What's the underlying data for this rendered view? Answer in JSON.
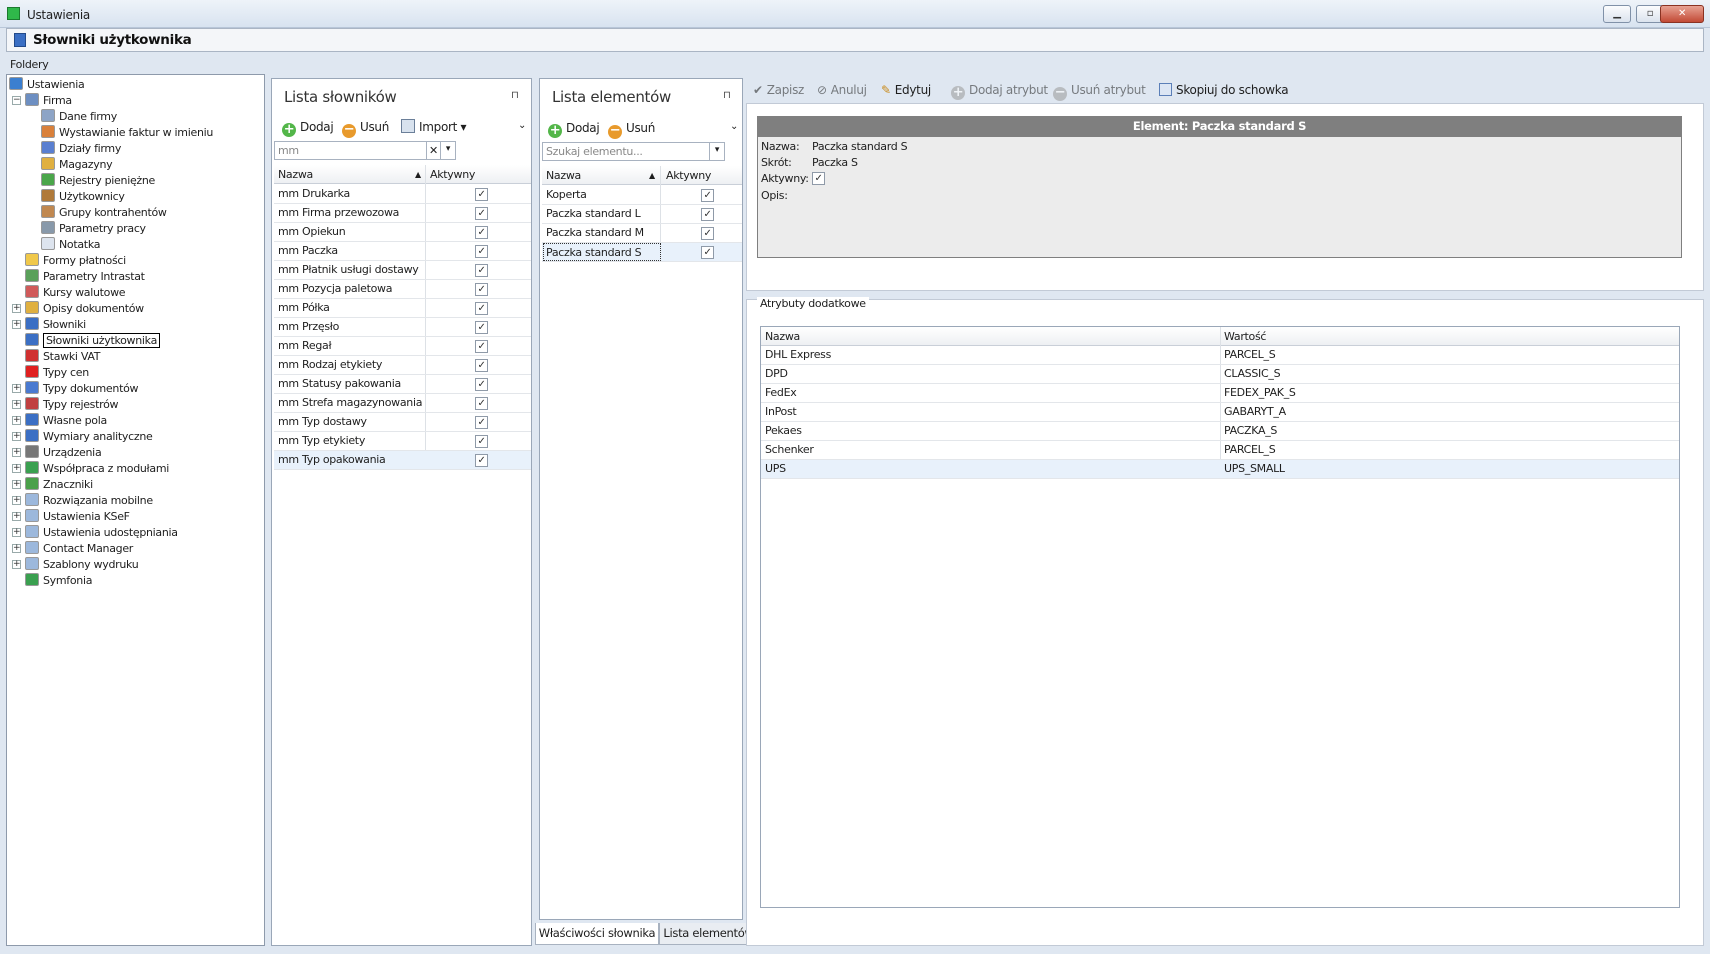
{
  "window": {
    "title": "Ustawienia",
    "btn_min": "▁",
    "btn_max": "▫",
    "btn_close": "✕"
  },
  "header": {
    "title": "Słowniki użytkownika"
  },
  "folders": {
    "label": "Foldery",
    "tree": [
      {
        "label": "Ustawienia",
        "level": 0,
        "expander": "",
        "icon_color": "#3b7fd0"
      },
      {
        "label": "Firma",
        "level": 1,
        "expander": "−",
        "icon_color": "#6d8fc2"
      },
      {
        "label": "Dane firmy",
        "level": 2,
        "expander": "",
        "icon_color": "#8da4c6"
      },
      {
        "label": "Wystawianie faktur w imieniu",
        "level": 2,
        "expander": "",
        "icon_color": "#d9803a"
      },
      {
        "label": "Działy firmy",
        "level": 2,
        "expander": "",
        "icon_color": "#5a7fd0"
      },
      {
        "label": "Magazyny",
        "level": 2,
        "expander": "",
        "icon_color": "#e0b040"
      },
      {
        "label": "Rejestry pieniężne",
        "level": 2,
        "expander": "",
        "icon_color": "#4aa64a"
      },
      {
        "label": "Użytkownicy",
        "level": 2,
        "expander": "",
        "icon_color": "#b07a3a"
      },
      {
        "label": "Grupy kontrahentów",
        "level": 2,
        "expander": "",
        "icon_color": "#c08850"
      },
      {
        "label": "Parametry pracy",
        "level": 2,
        "expander": "",
        "icon_color": "#8899aa"
      },
      {
        "label": "Notatka",
        "level": 2,
        "expander": "",
        "icon_color": "#dde4ee"
      },
      {
        "label": "Formy płatności",
        "level": 1,
        "expander": "",
        "icon_color": "#f0c84a"
      },
      {
        "label": "Parametry Intrastat",
        "level": 1,
        "expander": "",
        "icon_color": "#5aa05a"
      },
      {
        "label": "Kursy walutowe",
        "level": 1,
        "expander": "",
        "icon_color": "#d05a5a"
      },
      {
        "label": "Opisy dokumentów",
        "level": 1,
        "expander": "+",
        "icon_color": "#e0b040"
      },
      {
        "label": "Słowniki",
        "level": 1,
        "expander": "+",
        "icon_color": "#3b6fc4"
      },
      {
        "label": "Słowniki użytkownika",
        "level": 1,
        "expander": "",
        "icon_color": "#3b6fc4",
        "selected": true
      },
      {
        "label": "Stawki VAT",
        "level": 1,
        "expander": "",
        "icon_color": "#d03030"
      },
      {
        "label": "Typy cen",
        "level": 1,
        "expander": "",
        "icon_color": "#e02020"
      },
      {
        "label": "Typy dokumentów",
        "level": 1,
        "expander": "+",
        "icon_color": "#4a7ad0"
      },
      {
        "label": "Typy rejestrów",
        "level": 1,
        "expander": "+",
        "icon_color": "#c04040"
      },
      {
        "label": "Własne pola",
        "level": 1,
        "expander": "+",
        "icon_color": "#3b6fc4"
      },
      {
        "label": "Wymiary analityczne",
        "level": 1,
        "expander": "+",
        "icon_color": "#3b6fc4"
      },
      {
        "label": "Urządzenia",
        "level": 1,
        "expander": "+",
        "icon_color": "#777777"
      },
      {
        "label": "Współpraca z modułami",
        "level": 1,
        "expander": "+",
        "icon_color": "#3aa050"
      },
      {
        "label": "Znaczniki",
        "level": 1,
        "expander": "+",
        "icon_color": "#4aa04a"
      },
      {
        "label": "Rozwiązania mobilne",
        "level": 1,
        "expander": "+",
        "icon_color": "#9cb8dc"
      },
      {
        "label": "Ustawienia KSeF",
        "level": 1,
        "expander": "+",
        "icon_color": "#9cb8dc"
      },
      {
        "label": "Ustawienia udostępniania",
        "level": 1,
        "expander": "+",
        "icon_color": "#9cb8dc"
      },
      {
        "label": "Contact Manager",
        "level": 1,
        "expander": "+",
        "icon_color": "#9cb8dc"
      },
      {
        "label": "Szablony wydruku",
        "level": 1,
        "expander": "+",
        "icon_color": "#9cb8dc"
      },
      {
        "label": "Symfonia",
        "level": 1,
        "expander": "",
        "icon_color": "#3aa050"
      }
    ]
  },
  "dictionaries": {
    "title": "Lista słowników",
    "pin": "⊓",
    "add": "Dodaj",
    "remove": "Usuń",
    "import": "Import",
    "search_value": "mm",
    "clear": "✕",
    "col_name": "Nazwa",
    "col_active": "Aktywny",
    "rows": [
      {
        "name": "mm Drukarka",
        "active": "✓"
      },
      {
        "name": "mm Firma przewozowa",
        "active": "✓"
      },
      {
        "name": "mm Opiekun",
        "active": "✓"
      },
      {
        "name": "mm Paczka",
        "active": "✓"
      },
      {
        "name": "mm Płatnik usługi dostawy",
        "active": "✓"
      },
      {
        "name": "mm Pozycja paletowa",
        "active": "✓"
      },
      {
        "name": "mm Półka",
        "active": "✓"
      },
      {
        "name": "mm Przęsło",
        "active": "✓"
      },
      {
        "name": "mm Regał",
        "active": "✓"
      },
      {
        "name": "mm Rodzaj etykiety",
        "active": "✓"
      },
      {
        "name": "mm Statusy pakowania",
        "active": "✓"
      },
      {
        "name": "mm Strefa magazynowania",
        "active": "✓"
      },
      {
        "name": "mm Typ dostawy",
        "active": "✓"
      },
      {
        "name": "mm Typ etykiety",
        "active": "✓"
      },
      {
        "name": "mm Typ opakowania",
        "active": "✓",
        "selected": true
      }
    ]
  },
  "elements": {
    "title": "Lista elementów",
    "pin": "⊓",
    "add": "Dodaj",
    "remove": "Usuń",
    "search_placeholder": "Szukaj elementu...",
    "col_name": "Nazwa",
    "col_active": "Aktywny",
    "rows": [
      {
        "name": "Koperta",
        "active": "✓"
      },
      {
        "name": "Paczka standard L",
        "active": "✓"
      },
      {
        "name": "Paczka standard M",
        "active": "✓"
      },
      {
        "name": "Paczka standard S",
        "active": "✓",
        "selected": true
      }
    ],
    "tabs": [
      "Właściwości słownika",
      "Lista elementów"
    ]
  },
  "toolbar": {
    "save": "Zapisz",
    "cancel": "Anuluj",
    "edit": "Edytuj",
    "add_attr": "Dodaj atrybut",
    "remove_attr": "Usuń atrybut",
    "copy": "Skopiuj do schowka"
  },
  "detail": {
    "header": "Element: Paczka standard S",
    "name_label": "Nazwa:",
    "name_value": "Paczka standard S",
    "short_label": "Skrót:",
    "short_value": "Paczka S",
    "active_label": "Aktywny:",
    "active_value": "✓",
    "desc_label": "Opis:"
  },
  "attributes": {
    "title": "Atrybuty dodatkowe",
    "col_name": "Nazwa",
    "col_value": "Wartość",
    "rows": [
      {
        "name": "DHL Express",
        "value": "PARCEL_S"
      },
      {
        "name": "DPD",
        "value": "CLASSIC_S"
      },
      {
        "name": "FedEx",
        "value": "FEDEX_PAK_S"
      },
      {
        "name": "InPost",
        "value": "GABARYT_A"
      },
      {
        "name": "Pekaes",
        "value": "PACZKA_S"
      },
      {
        "name": "Schenker",
        "value": "PARCEL_S"
      },
      {
        "name": "UPS",
        "value": "UPS_SMALL",
        "selected": true
      }
    ]
  }
}
